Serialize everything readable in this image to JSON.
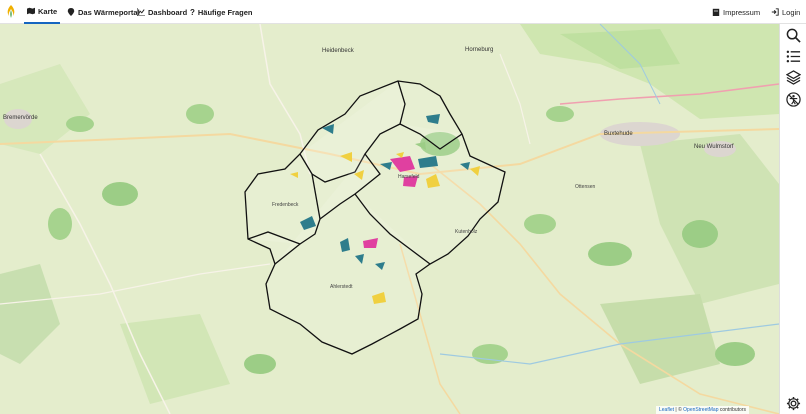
{
  "nav": {
    "items": [
      {
        "label": "Karte",
        "icon": "map-icon"
      },
      {
        "label": "Das Wärmeportal",
        "icon": "pin-icon"
      },
      {
        "label": "Dashboard",
        "icon": "chart-icon"
      },
      {
        "label": "Häufige Fragen",
        "icon": "question-icon"
      }
    ],
    "right": [
      {
        "label": "Impressum",
        "icon": "building-icon"
      },
      {
        "label": "Login",
        "icon": "login-icon"
      }
    ]
  },
  "toolbar": [
    "search-icon",
    "list-icon",
    "layers-icon",
    "accessibility-icon",
    "settings-icon"
  ],
  "map": {
    "places": [
      "Heidenbeck",
      "Horneburg",
      "Buxtehude",
      "Neu Wulmstorf",
      "Bremervörde",
      "Ottensen",
      "Kutenholz",
      "Harsefeld",
      "Ahlerstedt",
      "Fredenbeck"
    ],
    "attribution": {
      "leaflet": "Leaflet",
      "sep": " | © ",
      "osm": "OpenStreetMap",
      "suffix": " contributors"
    }
  },
  "colors": {
    "accent": "#1565c0",
    "border": "#111111",
    "magenta": "#e040a0",
    "yellow": "#f0d040",
    "teal": "#2e7d8c"
  }
}
